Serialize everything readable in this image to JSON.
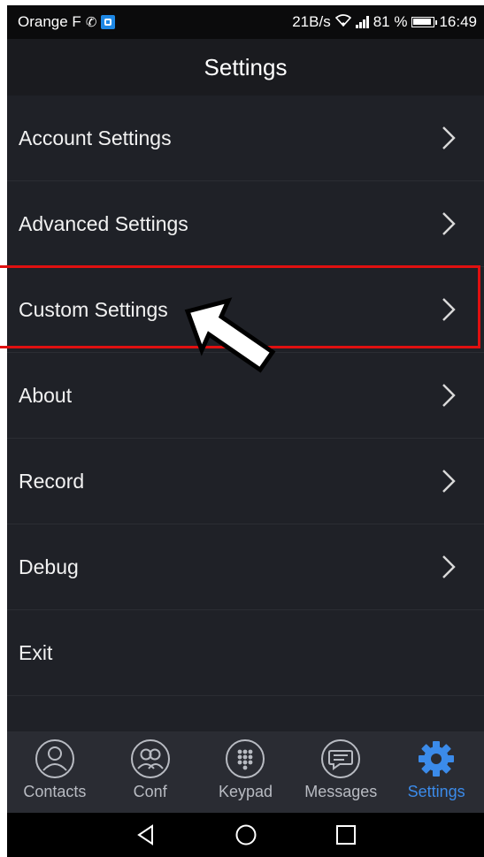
{
  "status_bar": {
    "carrier": "Orange F",
    "net_speed": "21B/s",
    "battery": "81 %",
    "time": "16:49"
  },
  "header": {
    "title": "Settings"
  },
  "menu": {
    "items": [
      {
        "label": "Account Settings",
        "has_chevron": true
      },
      {
        "label": "Advanced Settings",
        "has_chevron": true
      },
      {
        "label": "Custom Settings",
        "has_chevron": true,
        "highlighted": true
      },
      {
        "label": "About",
        "has_chevron": true
      },
      {
        "label": "Record",
        "has_chevron": true
      },
      {
        "label": "Debug",
        "has_chevron": true
      },
      {
        "label": "Exit",
        "has_chevron": false
      }
    ]
  },
  "tabs": [
    {
      "label": "Contacts",
      "icon": "contacts-icon",
      "active": false
    },
    {
      "label": "Conf",
      "icon": "conference-icon",
      "active": false
    },
    {
      "label": "Keypad",
      "icon": "keypad-icon",
      "active": false
    },
    {
      "label": "Messages",
      "icon": "messages-icon",
      "active": false
    },
    {
      "label": "Settings",
      "icon": "gear-icon",
      "active": true
    }
  ],
  "colors": {
    "background": "#1f2127",
    "accent": "#3b8bea",
    "highlight": "#e01010"
  }
}
